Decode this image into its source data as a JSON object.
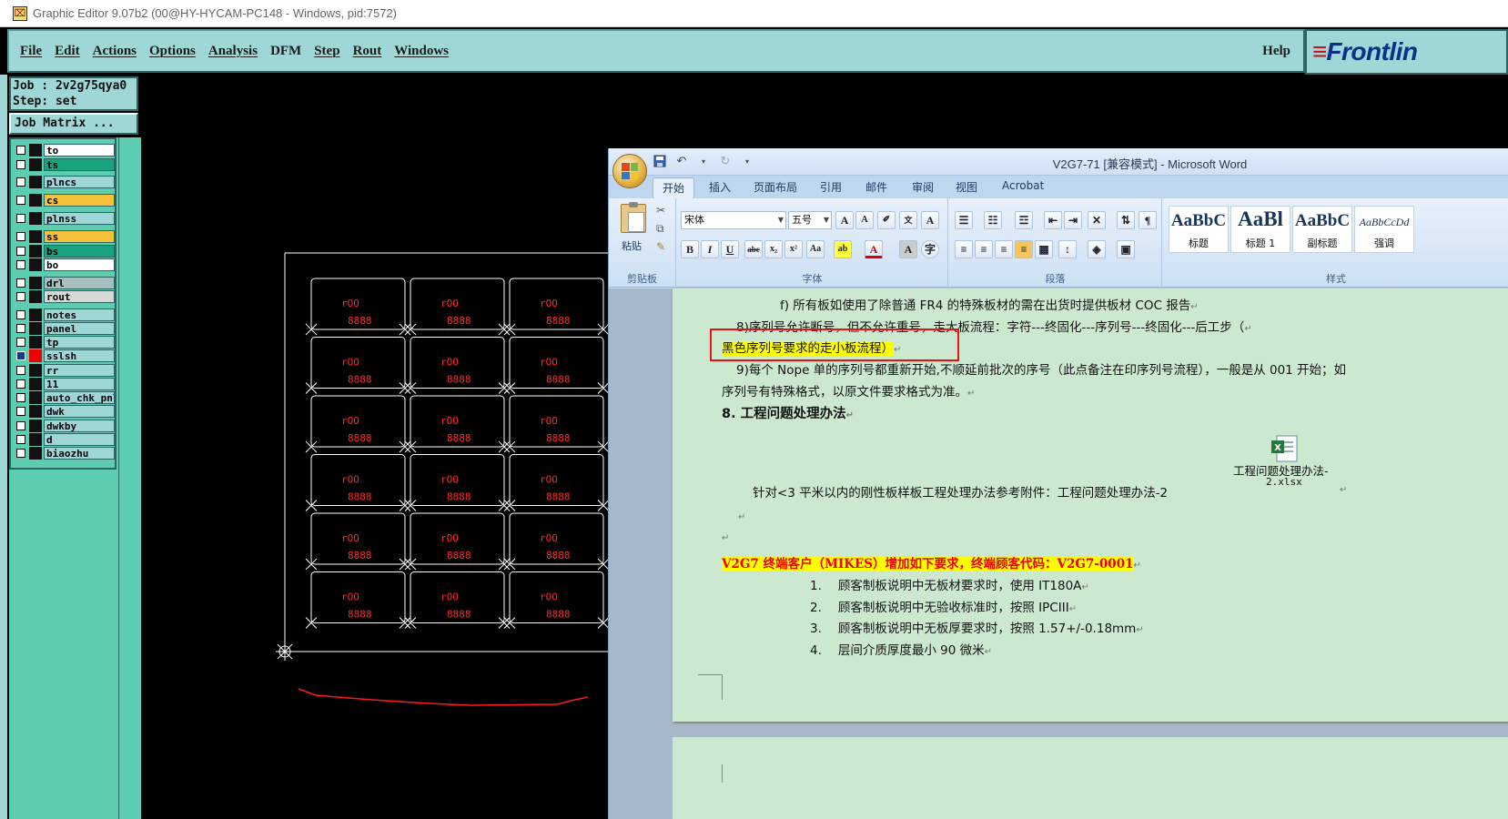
{
  "graphic_editor": {
    "window_title": "Graphic Editor 9.07b2 (00@HY-HYCAM-PC148 - Windows, pid:7572)",
    "menu": [
      "File",
      "Edit",
      "Actions",
      "Options",
      "Analysis",
      "DFM",
      "Step",
      "Rout",
      "Windows"
    ],
    "help_label": "Help",
    "brand_text": "Frontlin",
    "job_label": "Job : 2v2g75qya0",
    "step_label": "Step: set",
    "job_matrix_label": "Job Matrix ...",
    "layers": [
      {
        "name": "to",
        "bg": "#ffffff",
        "checked": false,
        "marker": "#111111"
      },
      {
        "name": "ts",
        "bg": "#1aa37f",
        "checked": false,
        "marker": "#111111"
      },
      {
        "name": "plncs",
        "bg": "#9fd7d7",
        "checked": false,
        "marker": "#111111"
      },
      {
        "name": "cs",
        "bg": "#f6c23a",
        "checked": false,
        "marker": "#111111"
      },
      {
        "name": "plnss",
        "bg": "#9fd7d7",
        "checked": false,
        "marker": "#111111"
      },
      {
        "name": "ss",
        "bg": "#f6c23a",
        "checked": false,
        "marker": "#111111"
      },
      {
        "name": "bs",
        "bg": "#1aa37f",
        "checked": false,
        "marker": "#111111"
      },
      {
        "name": "bo",
        "bg": "#ffffff",
        "checked": false,
        "marker": "#111111"
      },
      {
        "name": "drl",
        "bg": "#a8c0c0",
        "checked": false,
        "marker": "#111111"
      },
      {
        "name": "rout",
        "bg": "#d8d8d8",
        "checked": false,
        "marker": "#111111"
      },
      {
        "name": "notes",
        "bg": "#9fd7d7",
        "checked": false,
        "marker": "#111111"
      },
      {
        "name": "panel",
        "bg": "#9fd7d7",
        "checked": false,
        "marker": "#111111"
      },
      {
        "name": "tp",
        "bg": "#9fd7d7",
        "checked": false,
        "marker": "#111111"
      },
      {
        "name": "sslsh",
        "bg": "#9fd7d7",
        "checked": true,
        "marker": "#ee0000"
      },
      {
        "name": "rr",
        "bg": "#9fd7d7",
        "checked": false,
        "marker": "#111111"
      },
      {
        "name": "11",
        "bg": "#9fd7d7",
        "checked": false,
        "marker": "#111111"
      },
      {
        "name": "auto_chk_pnl",
        "bg": "#9fd7d7",
        "checked": false,
        "marker": "#111111"
      },
      {
        "name": "dwk",
        "bg": "#9fd7d7",
        "checked": false,
        "marker": "#111111"
      },
      {
        "name": "dwkby",
        "bg": "#9fd7d7",
        "checked": false,
        "marker": "#111111"
      },
      {
        "name": "d",
        "bg": "#9fd7d7",
        "checked": false,
        "marker": "#111111"
      },
      {
        "name": "biaozhu",
        "bg": "#9fd7d7",
        "checked": false,
        "marker": "#111111"
      }
    ],
    "board": {
      "rows": 6,
      "cols": 3,
      "cell_text_top": "rOO",
      "cell_text_bottom": "8888",
      "colors": {
        "outline": "#ffffff",
        "text": "#ff2a2a",
        "curve": "#ff1a1a"
      }
    }
  },
  "word": {
    "window_title": "V2G7-71 [兼容模式] - Microsoft Word",
    "tabs": [
      "开始",
      "插入",
      "页面布局",
      "引用",
      "邮件",
      "审阅",
      "视图",
      "Acrobat"
    ],
    "active_tab": "开始",
    "clipboard": {
      "paste_label": "粘贴",
      "group_label": "剪贴板"
    },
    "font": {
      "font_name": "宋体",
      "font_size": "五号",
      "group_label": "字体"
    },
    "paragraph": {
      "group_label": "段落"
    },
    "styles": {
      "group_label": "样式",
      "items": [
        {
          "sample": "AaBbC",
          "name": "标题"
        },
        {
          "sample": "AaBl",
          "name": "标题 1"
        },
        {
          "sample": "AaBbC",
          "name": "副标题"
        },
        {
          "sample": "AaBbCcDd",
          "name": "强调"
        }
      ]
    },
    "doc": {
      "line_f": "f)  所有板如使用了除普通 FR4 的特殊板材的需在出货时提供板材 COC 报告",
      "line_8_serial": "8)序列号允许断号，但不允许重号，走大板流程：字符---终固化---序列号---终固化---后工步（",
      "line_8_highlight": "黑色序列号要求的走小板流程）",
      "line_9a": "9)每个 Nope 单的序列号都重新开始,不顺延前批次的序号（此点备注在印序列号流程），一般是从 001 开始；如",
      "line_9b": "序列号有特殊格式，以原文件要求格式为准。",
      "heading_8": "8. 工程问题处理办法",
      "attachment_line1": "工程问题处理办法-",
      "attachment_line2": "2.xlsx",
      "attachment_ref": "针对<3 平米以内的刚性板样板工程处理办法参考附件：工程问题处理办法-2",
      "customer_line": "V2G7 终端客户（MIKES）增加如下要求，终端顾客代码：V2G7-0001",
      "list": [
        {
          "num": "1.",
          "text": "顾客制板说明中无板材要求时，使用 IT180A"
        },
        {
          "num": "2.",
          "text": "顾客制板说明中无验收标准时，按照 IPCIII"
        },
        {
          "num": "3.",
          "text": "顾客制板说明中无板厚要求时，按照 1.57+/-0.18mm"
        },
        {
          "num": "4.",
          "text": "层间介质厚度最小 90 微米"
        }
      ],
      "return_mark": "↵"
    }
  }
}
